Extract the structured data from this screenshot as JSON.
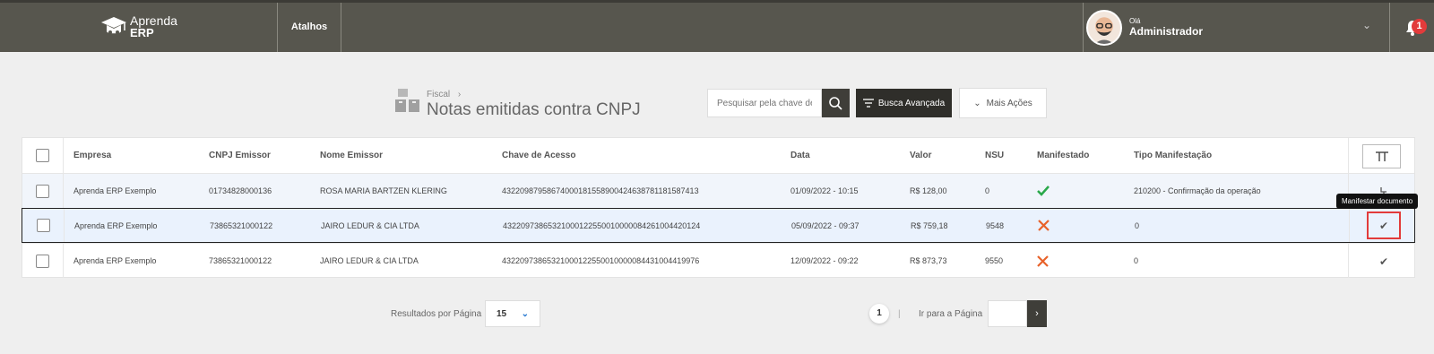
{
  "header": {
    "logo_line1": "Aprenda",
    "logo_line2": "ERP",
    "shortcuts_label": "Atalhos",
    "greeting": "Olá",
    "user_name": "Administrador",
    "notification_count": "1"
  },
  "page": {
    "breadcrumb": "Fiscal",
    "breadcrumb_sep": "›",
    "title": "Notas emitidas contra CNPJ",
    "search_placeholder": "Pesquisar pela chave de",
    "advanced_search_label": "Busca Avançada",
    "more_actions_label": "Mais Ações"
  },
  "table": {
    "columns": [
      "Empresa",
      "CNPJ Emissor",
      "Nome Emissor",
      "Chave de Acesso",
      "Data",
      "Valor",
      "NSU",
      "Manifestado",
      "Tipo Manifestação"
    ],
    "rows": [
      {
        "empresa": "Aprenda ERP Exemplo",
        "cnpj": "01734828000136",
        "nome": "ROSA MARIA BARTZEN KLERING",
        "chave": "43220987958674000181558900424638781181587413",
        "data": "01/09/2022 - 10:15",
        "valor": "R$ 128,00",
        "nsu": "0",
        "manifestado": "yes",
        "tipo": "210200 - Confirmação da operação"
      },
      {
        "empresa": "Aprenda ERP Exemplo",
        "cnpj": "73865321000122",
        "nome": "JAIRO LEDUR & CIA LTDA",
        "chave": "43220973865321000122550010000084261004420124",
        "data": "05/09/2022 - 09:37",
        "valor": "R$ 759,18",
        "nsu": "9548",
        "manifestado": "no",
        "tipo": "0"
      },
      {
        "empresa": "Aprenda ERP Exemplo",
        "cnpj": "73865321000122",
        "nome": "JAIRO LEDUR & CIA LTDA",
        "chave": "43220973865321000122550010000084431004419976",
        "data": "12/09/2022 - 09:22",
        "valor": "R$ 873,73",
        "nsu": "9550",
        "manifestado": "no",
        "tipo": "0"
      }
    ],
    "tooltip": "Manifestar documento"
  },
  "pagination": {
    "per_page_label": "Resultados por Página",
    "per_page_value": "15",
    "current_page": "1",
    "separator": "|",
    "goto_label": "Ir para a Página"
  },
  "colors": {
    "topbar": "#57564e",
    "accent_dark": "#2f2e2a",
    "check": "#2aa84a",
    "cross": "#e8622a",
    "highlight": "#e23b3b"
  }
}
